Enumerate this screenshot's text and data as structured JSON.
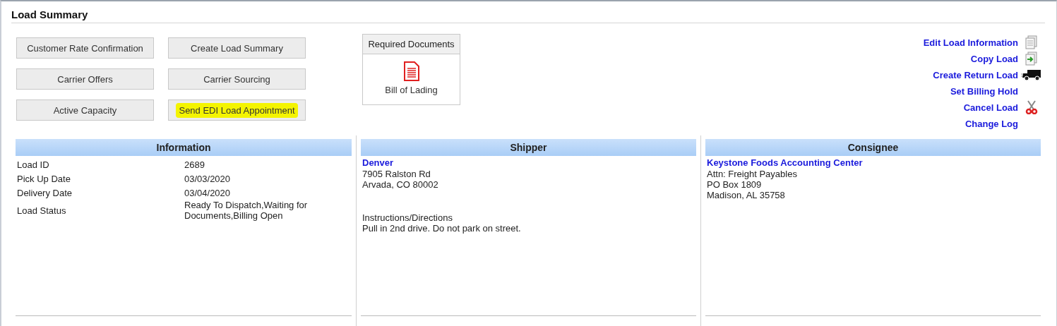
{
  "title": "Load Summary",
  "buttons": [
    {
      "label": "Customer Rate Confirmation",
      "highlighted": false
    },
    {
      "label": "Create Load Summary",
      "highlighted": false
    },
    {
      "label": "Carrier Offers",
      "highlighted": false
    },
    {
      "label": "Carrier Sourcing",
      "highlighted": false
    },
    {
      "label": "Active Capacity",
      "highlighted": false
    },
    {
      "label": "Send EDI Load Appointment",
      "highlighted": true
    }
  ],
  "required_documents": {
    "heading": "Required Documents",
    "documents": [
      {
        "label": "Bill of Lading"
      }
    ]
  },
  "actions": [
    {
      "label": "Edit Load Information",
      "kind": "document"
    },
    {
      "label": "Copy Load",
      "kind": "copy"
    },
    {
      "label": "Create Return Load",
      "kind": "truck"
    },
    {
      "label": "Set Billing Hold",
      "kind": "plain"
    },
    {
      "label": "Cancel Load",
      "kind": "scissors"
    },
    {
      "label": "Change Log",
      "kind": "plain"
    }
  ],
  "information": {
    "heading": "Information",
    "rows": [
      {
        "label": "Load ID",
        "value": "2689"
      },
      {
        "label": "Pick Up Date",
        "value": "03/03/2020"
      },
      {
        "label": "Delivery Date",
        "value": "03/04/2020"
      },
      {
        "label": "Load Status",
        "value": "Ready To Dispatch,Waiting for Documents,Billing Open"
      }
    ]
  },
  "shipper": {
    "heading": "Shipper",
    "name": "Denver",
    "lines": [
      "7905 Ralston Rd",
      "Arvada, CO 80002"
    ],
    "instructions_label": "Instructions/Directions",
    "instructions": "Pull in 2nd drive. Do not park on street."
  },
  "consignee": {
    "heading": "Consignee",
    "name": "Keystone Foods Accounting Center",
    "lines": [
      "Attn: Freight Payables",
      "PO Box 1809",
      "Madison, AL 35758"
    ]
  }
}
